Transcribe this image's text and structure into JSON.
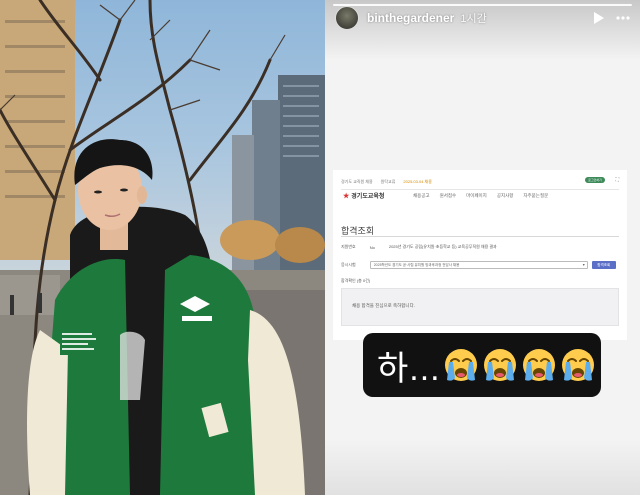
{
  "story": {
    "username": "binthegardener",
    "time": "1시간"
  },
  "webpage": {
    "topbar": [
      "경기도 교직원 채용",
      "원탁교류",
      "2025.03.04 채용"
    ],
    "pill_label": "로그인하기",
    "expand_icon": "expand-icon",
    "brand_name": "경기도교육청",
    "nav_items": [
      "채용공고",
      "원서접수",
      "마이페이지",
      "공지사항",
      "자주묻는질문"
    ],
    "title": "합격조회",
    "row1_label": "지원번호",
    "row1_value": "No",
    "row1_detail": "2025년 경기도 공립(유치원·초등학교 등) 교육공무직원 채용 결과",
    "row2_label": "응시시험",
    "row2_select": "2025학년도 경기도 공·사립 유치원 방과후과정 전담사 채용",
    "row2_button": "합격조회",
    "result_label": "합격확인 (총 0건)",
    "result_message": "채용 합격을 진심으로 축하합니다."
  },
  "sticker": {
    "text": "하...",
    "emoji_count": 4,
    "emoji_icon": "loudly-crying-face-icon"
  },
  "colors": {
    "jacket_green": "#1e7a3c",
    "sleeve_cream": "#efe9d6",
    "sky_blue": "#8fb6d9",
    "sticker_bg": "#111111",
    "pill_green": "#3d8a5a",
    "button_blue": "#5b6fc7"
  }
}
